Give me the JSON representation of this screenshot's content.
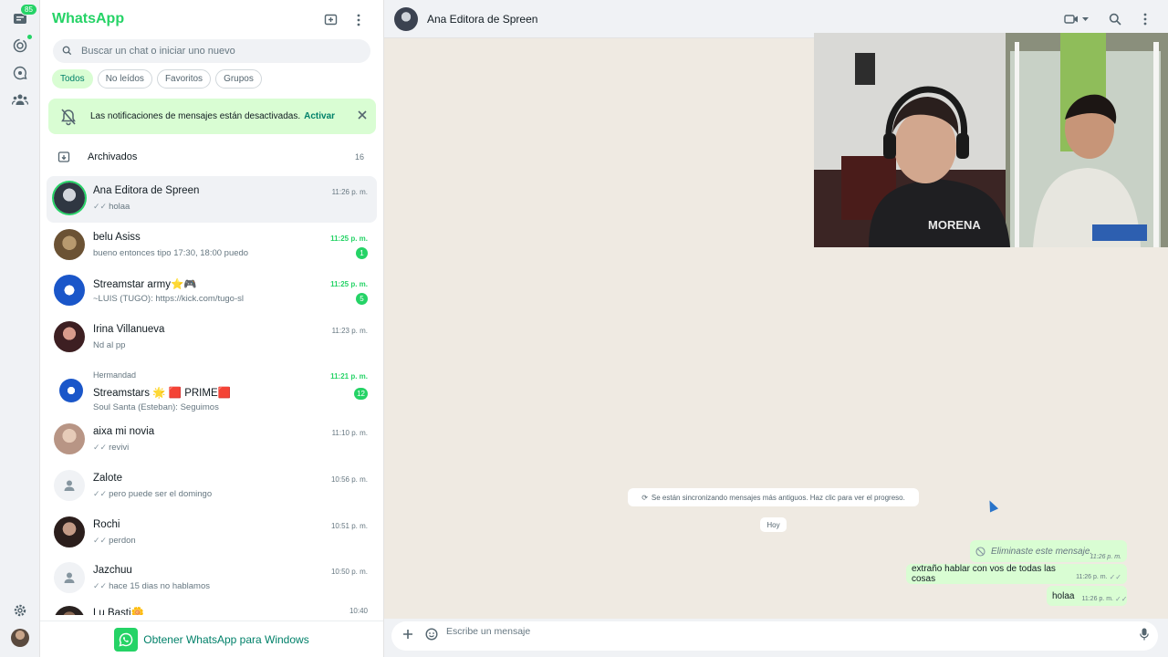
{
  "rail": {
    "chats_badge": "85",
    "icons": [
      "chats-icon",
      "status-icon",
      "channels-icon",
      "communities-icon",
      "settings-icon"
    ]
  },
  "sidebar": {
    "title": "WhatsApp",
    "search_placeholder": "Buscar un chat o iniciar uno nuevo",
    "filters": [
      "Todos",
      "No leídos",
      "Favoritos",
      "Grupos"
    ],
    "active_filter": "Todos",
    "notice_text": "Las notificaciones de mensajes están desactivadas.",
    "notice_action": "Activar",
    "archived_label": "Archivados",
    "archived_count": "16",
    "chats": [
      {
        "name": "Ana Editora de Spreen",
        "preview": "holaa",
        "time": "11:26 p. m.",
        "ticks": true
      },
      {
        "name": "belu Asiss",
        "preview": "bueno entonces tipo 17:30, 18:00 puedo",
        "time": "11:25 p. m.",
        "badge": "1"
      },
      {
        "name": "Streamstar army⭐🎮",
        "preview": "~LUIS (TUGO): https://kick.com/tugo-sl",
        "time": "11:25 p. m.",
        "badge": "5"
      },
      {
        "name": "Irina Villanueva",
        "preview": "Nd al pp",
        "time": "11:23 p. m."
      },
      {
        "group": "Hermandad",
        "name": "Streamstars 🌟 🟥 PRIME🟥",
        "preview": "Soul Santa (Esteban): Seguimos",
        "time": "11:21 p. m.",
        "badge": "12"
      },
      {
        "name": "aixa mi novia",
        "preview": "revivi",
        "time": "11:10 p. m.",
        "ticks": true
      },
      {
        "name": "Zalote",
        "preview": "pero puede ser el domingo",
        "time": "10:56 p. m.",
        "ticks": true
      },
      {
        "name": "Rochi",
        "preview": "perdon",
        "time": "10:51 p. m.",
        "ticks": true
      },
      {
        "name": "Jazchuu",
        "preview": "hace 15 dias no hablamos",
        "time": "10:50 p. m.",
        "ticks": true
      },
      {
        "name": "Lu Basti🌼",
        "preview": "",
        "time": "10:40"
      }
    ],
    "get_windows": "Obtener WhatsApp para Windows"
  },
  "conversation": {
    "contact_name": "Ana Editora de Spreen",
    "sync_notice": "Se están sincronizando mensajes más antiguos. Haz clic para ver el progreso.",
    "day_label": "Hoy",
    "messages": [
      {
        "text": "Eliminaste este mensaje.",
        "time": "11:26 p. m.",
        "deleted": true
      },
      {
        "text": "extraño hablar con vos de todas las cosas",
        "time": "11:26 p. m."
      },
      {
        "text": "holaa",
        "time": "11:26 p. m."
      }
    ],
    "composer_placeholder": "Escribe un mensaje"
  }
}
